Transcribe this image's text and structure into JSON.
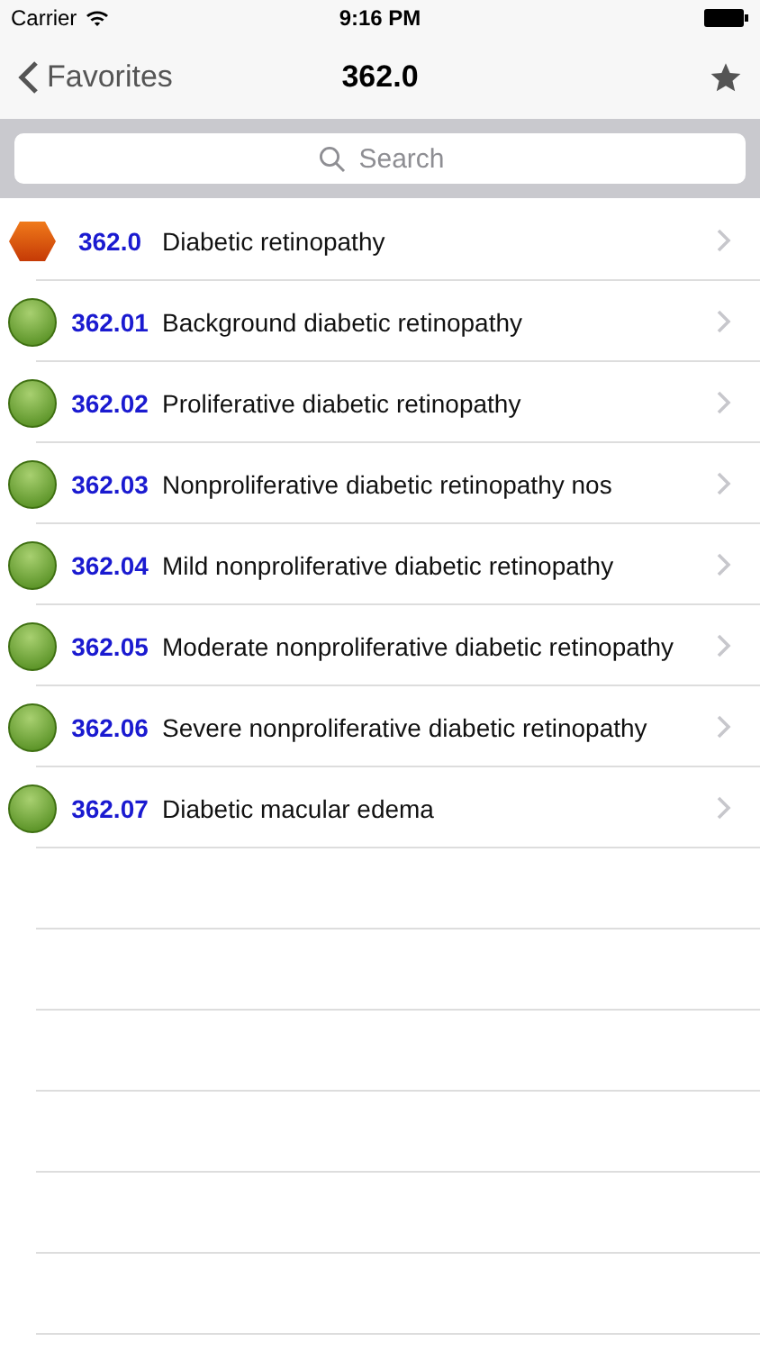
{
  "status_bar": {
    "carrier": "Carrier",
    "time": "9:16 PM"
  },
  "nav": {
    "back": "Favorites",
    "title": "362.0"
  },
  "search": {
    "placeholder": "Search"
  },
  "rows": [
    {
      "kind": "category",
      "code": "362.0",
      "label": "Diabetic retinopathy"
    },
    {
      "kind": "code",
      "code": "362.01",
      "label": "Background diabetic retinopathy"
    },
    {
      "kind": "code",
      "code": "362.02",
      "label": "Proliferative diabetic retinopathy"
    },
    {
      "kind": "code",
      "code": "362.03",
      "label": "Nonproliferative diabetic retinopathy nos"
    },
    {
      "kind": "code",
      "code": "362.04",
      "label": "Mild nonproliferative diabetic retinopathy"
    },
    {
      "kind": "code",
      "code": "362.05",
      "label": "Moderate nonproliferative diabetic retinopathy"
    },
    {
      "kind": "code",
      "code": "362.06",
      "label": "Severe nonproliferative diabetic retinopathy"
    },
    {
      "kind": "code",
      "code": "362.07",
      "label": "Diabetic macular edema"
    }
  ]
}
